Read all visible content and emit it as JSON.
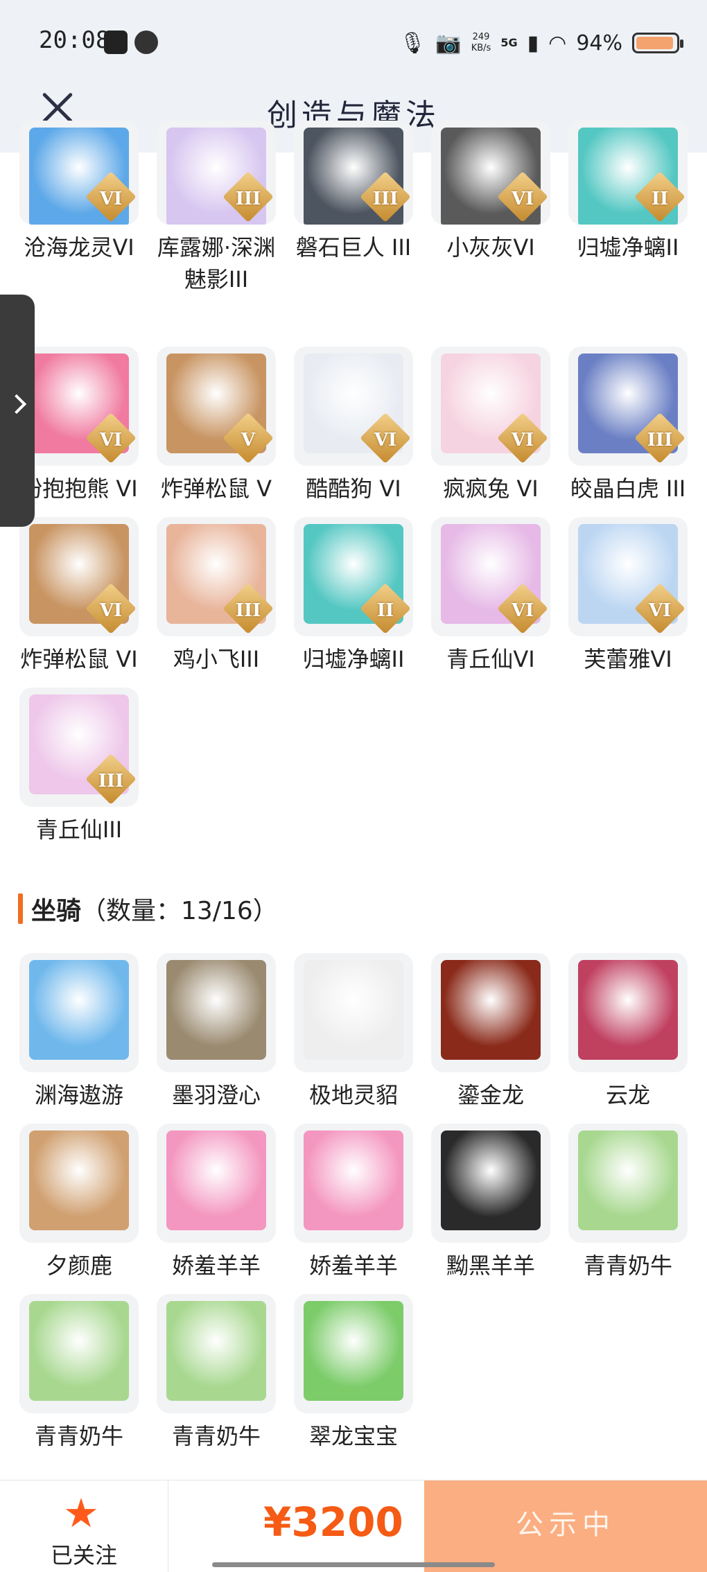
{
  "status_bar": {
    "time": "20:08",
    "speed_value": "249",
    "speed_unit": "KB/s",
    "network": "5G",
    "battery": "94%",
    "battery_level": 0.94
  },
  "header": {
    "title": "创造与魔法"
  },
  "skins": [
    {
      "label": "沧海龙灵VI",
      "badge": "VI",
      "color": "#5da8e8"
    },
    {
      "label": "库露娜·深渊魅影III",
      "badge": "III",
      "color": "#d7c6f0"
    },
    {
      "label": "磐石巨人 III",
      "badge": "III",
      "color": "#4d5560"
    },
    {
      "label": "小灰灰VI",
      "badge": "VI",
      "color": "#5a5a5a"
    },
    {
      "label": "归墟净螭II",
      "badge": "II",
      "color": "#54c7c2"
    },
    {
      "label": "粉抱抱熊 VI",
      "badge": "VI",
      "color": "#f07aa0"
    },
    {
      "label": "炸弹松鼠 V",
      "badge": "V",
      "color": "#c89462"
    },
    {
      "label": "酷酷狗 VI",
      "badge": "VI",
      "color": "#e8ecf2"
    },
    {
      "label": "疯疯兔 VI",
      "badge": "VI",
      "color": "#f6d3e0"
    },
    {
      "label": "皎晶白虎 III",
      "badge": "III",
      "color": "#6a7fc4"
    },
    {
      "label": "炸弹松鼠 VI",
      "badge": "VI",
      "color": "#c89462"
    },
    {
      "label": "鸡小飞III",
      "badge": "III",
      "color": "#e8b49a"
    },
    {
      "label": "归墟净螭II",
      "badge": "II",
      "color": "#54c7c2"
    },
    {
      "label": "青丘仙VI",
      "badge": "VI",
      "color": "#e6b9e6"
    },
    {
      "label": "芙蕾雅VI",
      "badge": "VI",
      "color": "#bcd6f2"
    },
    {
      "label": "青丘仙III",
      "badge": "III",
      "color": "#eec7ea"
    }
  ],
  "mounts_section": {
    "title": "坐骑",
    "count": "（数量：13/16）"
  },
  "mounts": [
    {
      "label": "渊海遨游",
      "color": "#70b8ec"
    },
    {
      "label": "墨羽澄心",
      "color": "#9a8a70"
    },
    {
      "label": "极地灵貂",
      "color": "#eeeeee"
    },
    {
      "label": "鎏金龙",
      "color": "#8a2a1a"
    },
    {
      "label": "云龙",
      "color": "#c04060"
    },
    {
      "label": "夕颜鹿",
      "color": "#d0a070"
    },
    {
      "label": "娇羞羊羊",
      "color": "#f497c0"
    },
    {
      "label": "娇羞羊羊",
      "color": "#f497c0"
    },
    {
      "label": "黝黑羊羊",
      "color": "#2a2a2a"
    },
    {
      "label": "青青奶牛",
      "color": "#a8d890"
    },
    {
      "label": "青青奶牛",
      "color": "#a8d890"
    },
    {
      "label": "青青奶牛",
      "color": "#a8d890"
    },
    {
      "label": "翠龙宝宝",
      "color": "#7ccc6a"
    }
  ],
  "bottom_bar": {
    "follow_label": "已关注",
    "price": "¥3200",
    "status_button": "公示中"
  },
  "colors": {
    "accent": "#f26d21",
    "price": "#f55b14",
    "status_button": "#fbae81"
  }
}
